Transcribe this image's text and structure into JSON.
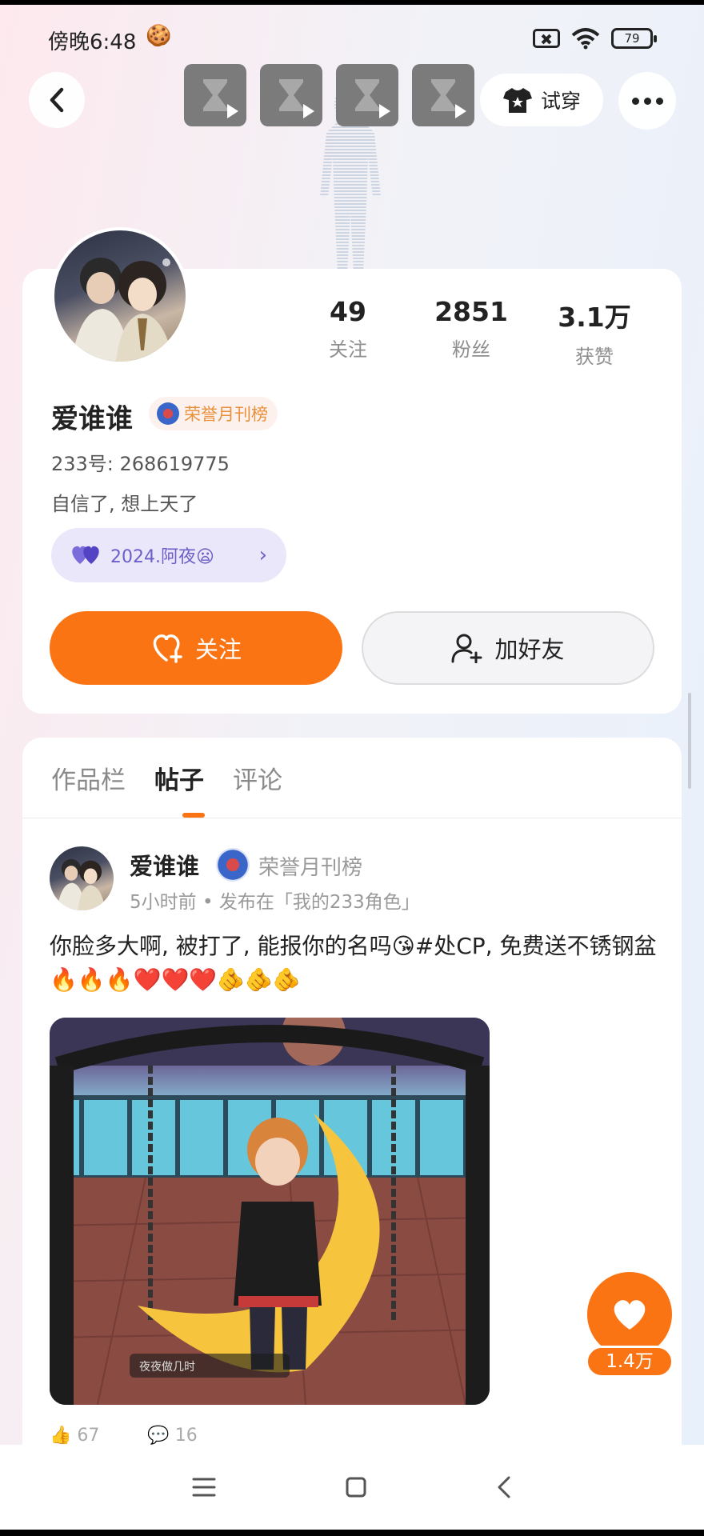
{
  "status_bar": {
    "time": "傍晚6:48",
    "notification_emoji": "🍪",
    "battery": "79"
  },
  "top_nav": {
    "tryon_label": "试穿",
    "thumb_count": 4
  },
  "profile": {
    "stats": [
      {
        "value": "49",
        "label": "关注"
      },
      {
        "value": "2851",
        "label": "粉丝"
      },
      {
        "value": "3.1万",
        "label": "获赞"
      }
    ],
    "username": "爱谁谁",
    "honor_badge": "荣誉月刊榜",
    "id_line": "233号: 268619775",
    "bio": "自信了, 想上天了",
    "tag": "2024.阿夜😦",
    "follow_label": "关注",
    "add_friend_label": "加好友"
  },
  "tabs": [
    {
      "label": "作品栏",
      "active": false
    },
    {
      "label": "帖子",
      "active": true
    },
    {
      "label": "评论",
      "active": false
    }
  ],
  "post": {
    "author": "爱谁谁",
    "honor": "荣誉月刊榜",
    "meta": "5小时前 • 发布在「我的233角色」",
    "text": "你脸多大啊, 被打了, 能报你的名吗😘#处CP, 免费送不锈钢盆🔥🔥🔥❤️❤️❤️🫵🫵🫵",
    "image_caption": "夜夜做几时",
    "like_count": "67",
    "comment_count": "16"
  },
  "fab": {
    "like_count": "1.4万"
  },
  "colors": {
    "accent": "#fb7414",
    "tag_bg": "#ebe7fb",
    "tag_text": "#6c5fc7",
    "honor_text": "#e8903a"
  }
}
